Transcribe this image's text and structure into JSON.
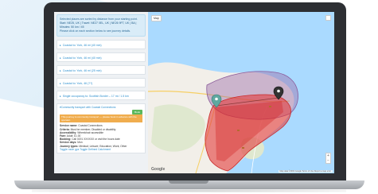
{
  "info": {
    "line1": "Selected places are sorted by distance from your starting point.",
    "line2": "Start: NE25, UK  |  Travel: NE27 0EL, UK  |  NE26 9FT, UK  |  BA  |  Minutes: 50 km / 45",
    "line3": "Please click on each section below to see journey details."
  },
  "accordion": [
    "Coastal to: York, 46 mi (40 min)",
    "Coastal to: York, 46 mi (40 min)",
    "Coastal to: York, 46 mi (25 min)",
    "Coastal to: York, 46 (??)",
    "Single occupancy to: Scottish Border – 17 mi / 1.5 km",
    "Community transport with Coastal Connections"
  ],
  "details": {
    "button": "Book",
    "warning": "This journey is community transport — please book in advance with the operator.",
    "rows": [
      {
        "k": "Service name:",
        "v": "Coastal Connections"
      },
      {
        "k": "Criteria:",
        "v": "Must be member; Disabled or disability"
      },
      {
        "k": "Accessibility:",
        "v": "Wheelchair accessible"
      },
      {
        "k": "Fare:",
        "v": "Adult: £1.00"
      },
      {
        "k": "Booking:",
        "v": "Call 0191 XXXXXX or visit the hours date"
      },
      {
        "k": "Service days:",
        "v": "Mon"
      },
      {
        "k": "Journey types:",
        "v": "Medical; Leisure; Education; Work; Other"
      }
    ],
    "link": "Toggle route gps Toggle Defined Catchment"
  },
  "map": {
    "toggle_label": "Map",
    "logo": "Google",
    "attribution": "Map data ©2019 Google  Terms of Use  Report a map error",
    "zoom_in": "+",
    "zoom_out": "−"
  },
  "colors": {
    "sea": "#aadaff",
    "land": "#f2efe9",
    "catchment_fill": "#e33b3b",
    "outer_area": "#9b6ca8"
  }
}
